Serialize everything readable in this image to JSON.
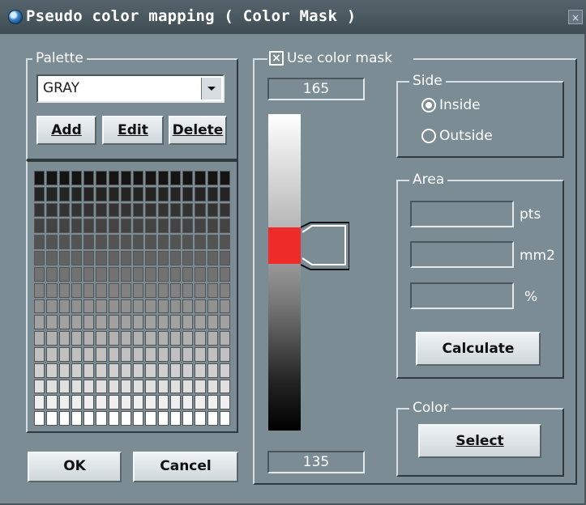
{
  "window": {
    "title": "Pseudo color mapping ( Color Mask )",
    "close_label": "×"
  },
  "palette": {
    "legend": "Palette",
    "selected": "GRAY",
    "add_label": "Add",
    "edit_label": "Edit",
    "delete_label": "Delete",
    "grid_rows": 16,
    "grid_cols": 16,
    "gradient": [
      "#000000",
      "#ffffff"
    ]
  },
  "mask": {
    "use_mask_label": "Use color mask",
    "use_mask_checked": true,
    "upper_value": "165",
    "lower_value": "135",
    "marker_color": "#ee2b28"
  },
  "side": {
    "legend": "Side",
    "options": [
      {
        "label": "Inside",
        "selected": true
      },
      {
        "label": "Outside",
        "selected": false
      }
    ]
  },
  "area": {
    "legend": "Area",
    "units": [
      "pts",
      "mm2",
      "%"
    ],
    "calculate_label": "Calculate"
  },
  "color": {
    "legend": "Color",
    "select_label": "Select"
  },
  "footer": {
    "ok_label": "OK",
    "cancel_label": "Cancel"
  }
}
